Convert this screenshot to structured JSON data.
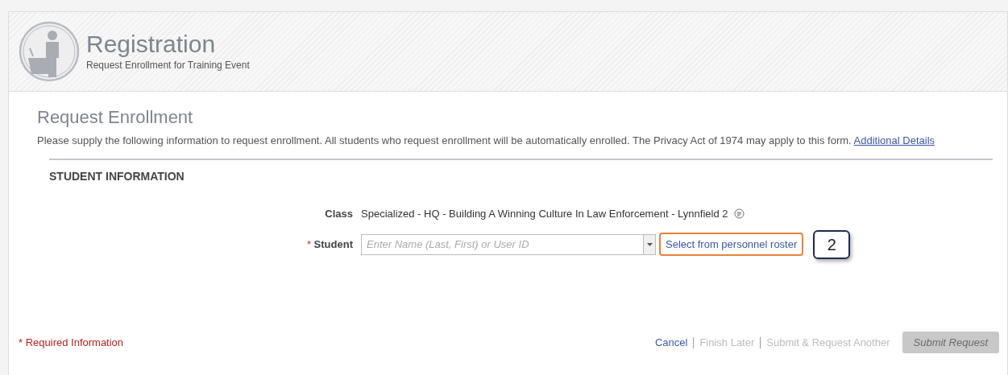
{
  "header": {
    "title": "Registration",
    "subtitle": "Request Enrollment for Training Event"
  },
  "form": {
    "title": "Request Enrollment",
    "intro": "Please supply the following information to request enrollment. All students who request enrollment will be automatically enrolled. The Privacy Act of 1974 may apply to this form.",
    "intro_link": "Additional Details",
    "section": "STUDENT INFORMATION",
    "class_label": "Class",
    "class_value": "Specialized - HQ - Building A Winning Culture In Law Enforcement - Lynnfield 2",
    "student": {
      "required_mark": "*",
      "label": "Student",
      "placeholder": "Enter Name (Last, First) or User ID"
    },
    "roster_link": {
      "label": "Select from personnel roster",
      "highlighted": true
    },
    "callout": "2"
  },
  "footer": {
    "required_note": "* Required Information",
    "actions": [
      {
        "label": "Cancel",
        "disabled": false
      },
      {
        "label": "Finish Later",
        "disabled": true
      },
      {
        "label": "Submit & Request Another",
        "disabled": true
      }
    ],
    "submit": {
      "label": "Submit Request",
      "disabled": true
    }
  }
}
